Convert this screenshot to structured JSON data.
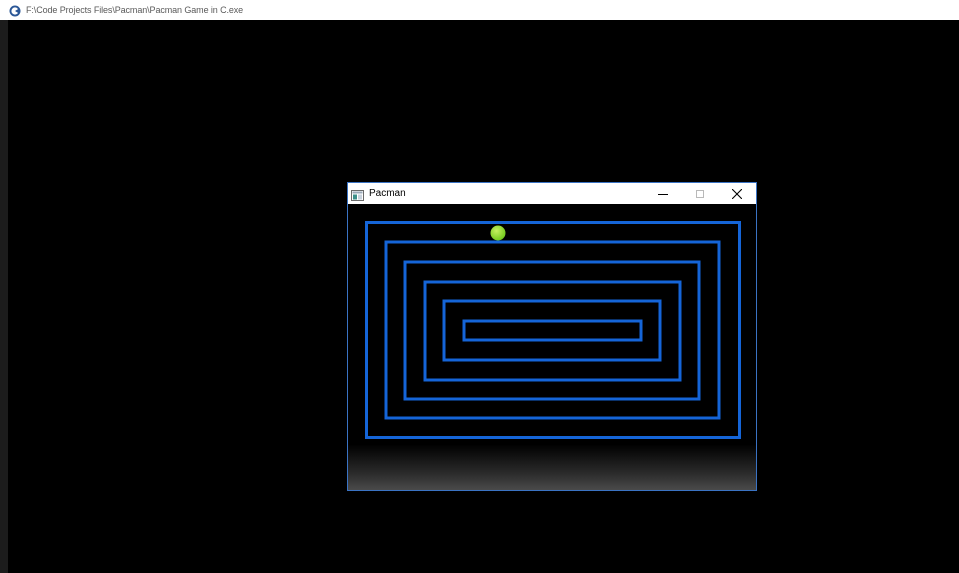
{
  "console": {
    "title": "F:\\Code Projects Files\\Pacman\\Pacman Game in C.exe",
    "icon": "console-app-icon",
    "title_color": "#5a5a5a"
  },
  "game_window": {
    "title": "Pacman",
    "icon": "window-app-icon",
    "buttons": {
      "minimize_icon": "minimize-icon",
      "maximize_icon": "maximize-icon",
      "close_icon": "close-icon"
    },
    "border_color": "#3a73c4"
  },
  "maze": {
    "wall_color": "#1565d8",
    "background": "#000000",
    "rings": 6
  },
  "pacman": {
    "color": "#6dc718",
    "highlight": "#c6f060"
  }
}
